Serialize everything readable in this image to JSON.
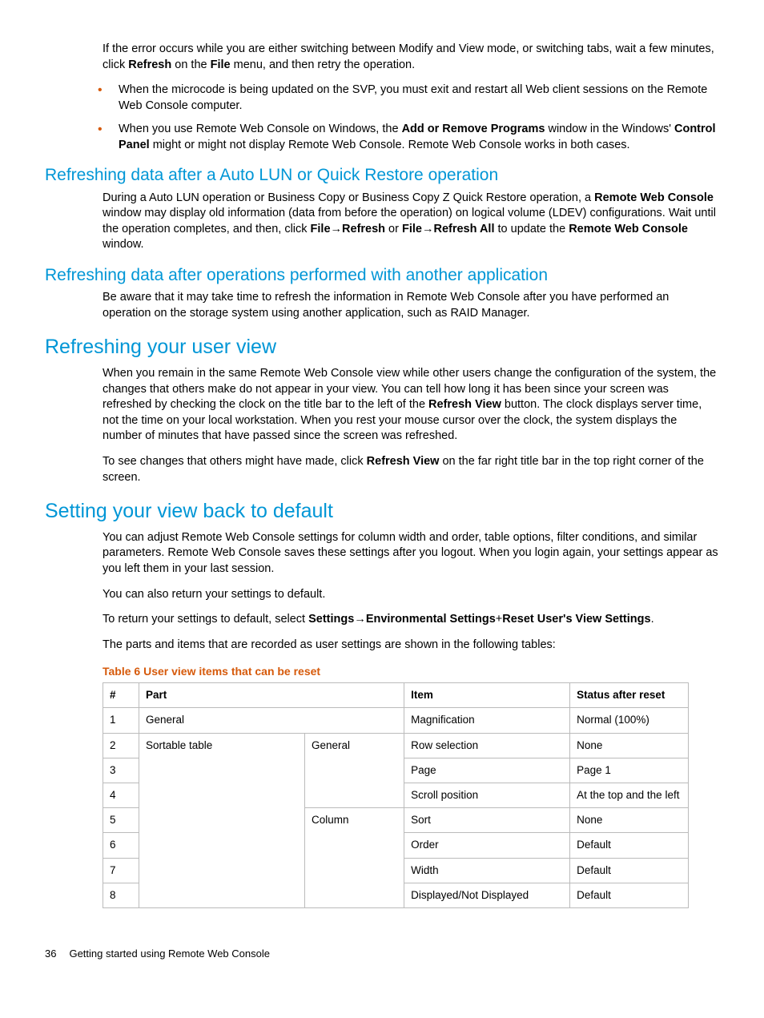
{
  "intro": {
    "p1a": "If the error occurs while you are either switching between Modify and View mode, or switching tabs, wait a few minutes, click ",
    "p1b": "Refresh",
    "p1c": " on the ",
    "p1d": "File",
    "p1e": " menu, and then retry the operation.",
    "bullet1": "When the microcode is being updated on the SVP, you must exit and restart all Web client sessions on the Remote Web Console computer.",
    "bullet2a": "When you use Remote Web Console on Windows, the ",
    "bullet2b": "Add or Remove Programs",
    "bullet2c": " window in the Windows' ",
    "bullet2d": "Control Panel",
    "bullet2e": " might or might not display Remote Web Console. Remote Web Console works in both cases."
  },
  "sec1": {
    "title": "Refreshing data after a Auto LUN or Quick Restore operation",
    "p1a": "During a Auto LUN operation or Business Copy or Business Copy Z Quick Restore operation, a ",
    "p1b": "Remote Web Console",
    "p1c": " window may display old information (data from before the operation) on logical volume (LDEV) configurations. Wait until the operation completes, and then, click ",
    "p1d": "File",
    "arrow": "→",
    "p1e": "Refresh",
    "p1f": " or ",
    "p1g": "File",
    "p1h": "Refresh All",
    "p1i": " to update the ",
    "p1j": "Remote Web Console",
    "p1k": " window."
  },
  "sec2": {
    "title": "Refreshing data after operations performed with another application",
    "p1": "Be aware that it may take time to refresh the information in Remote Web Console after you have performed an operation on the storage system using another application, such as RAID Manager."
  },
  "sec3": {
    "title": "Refreshing your user view",
    "p1a": "When you remain in the same Remote Web Console view while other users change the configuration of the system, the changes that others make do not appear in your view. You can tell how long it has been since your screen was refreshed by checking the clock on the title bar to the left of the ",
    "p1b": "Refresh View",
    "p1c": " button. The clock displays server time, not the time on your local workstation. When you rest your mouse cursor over the clock, the system displays the number of minutes that have passed since the screen was refreshed.",
    "p2a": "To see changes that others might have made, click ",
    "p2b": "Refresh View",
    "p2c": " on the far right title bar in the top right corner of the screen."
  },
  "sec4": {
    "title": "Setting your view back to default",
    "p1": "You can adjust Remote Web Console settings for column width and order, table options, filter conditions, and similar parameters. Remote Web Console saves these settings after you logout. When you login again, your settings appear as you left them in your last session.",
    "p2": "You can also return your settings to default.",
    "p3a": "To return your settings to default, select ",
    "p3b": "Settings",
    "p3c": "Environmental Settings",
    "plus": "+",
    "p3d": "Reset User's View Settings",
    "p3e": ".",
    "p4": "The parts and items that are recorded as user settings are shown in the following tables:"
  },
  "table": {
    "title": "Table 6 User view items that can be reset",
    "headers": {
      "num": "#",
      "part": "Part",
      "item": "Item",
      "status": "Status after reset"
    },
    "rows": [
      {
        "num": "1",
        "part": "General",
        "part2": "",
        "item": "Magnification",
        "status": "Normal (100%)"
      },
      {
        "num": "2",
        "part": "Sortable table",
        "part2": "General",
        "item": "Row selection",
        "status": "None"
      },
      {
        "num": "3",
        "part": "",
        "part2": "",
        "item": "Page",
        "status": "Page 1"
      },
      {
        "num": "4",
        "part": "",
        "part2": "",
        "item": "Scroll position",
        "status": "At the top and the left"
      },
      {
        "num": "5",
        "part": "",
        "part2": "Column",
        "item": "Sort",
        "status": "None"
      },
      {
        "num": "6",
        "part": "",
        "part2": "",
        "item": "Order",
        "status": "Default"
      },
      {
        "num": "7",
        "part": "",
        "part2": "",
        "item": "Width",
        "status": "Default"
      },
      {
        "num": "8",
        "part": "",
        "part2": "",
        "item": "Displayed/Not Displayed",
        "status": "Default"
      }
    ]
  },
  "footer": {
    "page": "36",
    "text": "Getting started using Remote Web Console"
  }
}
